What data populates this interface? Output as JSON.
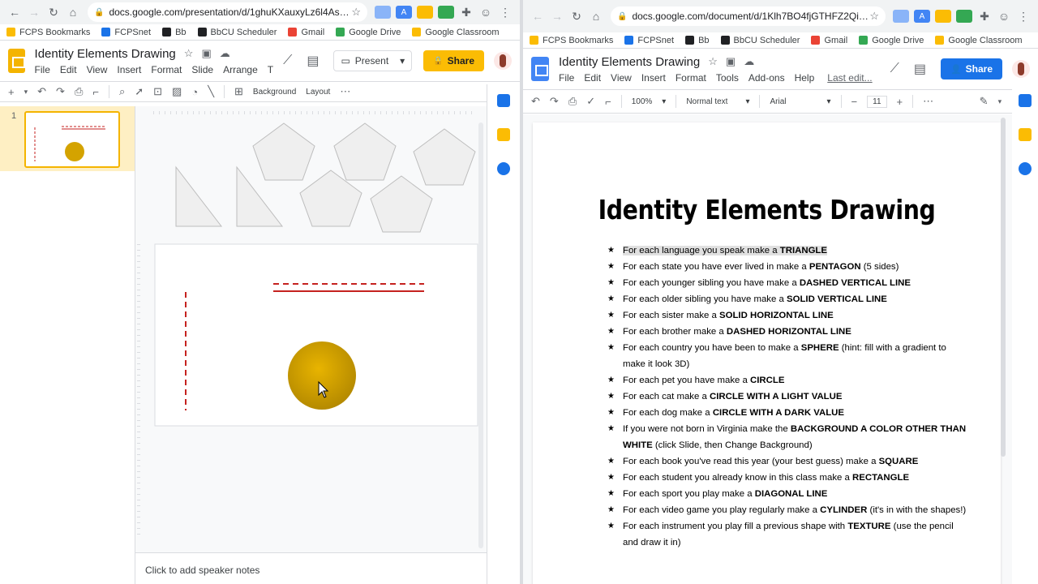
{
  "left": {
    "url": "docs.google.com/presentation/d/1ghuKXauxyLz6l4AsSO9wC...",
    "bookmarks": [
      "FCPS Bookmarks",
      "FCPSnet",
      "Bb",
      "BbCU Scheduler",
      "Gmail",
      "Google Drive",
      "Google Classroom"
    ],
    "title": "Identity Elements Drawing",
    "menus": [
      "File",
      "Edit",
      "View",
      "Insert",
      "Format",
      "Slide",
      "Arrange",
      "T"
    ],
    "present_label": "Present",
    "share_label": "Share",
    "toolbar": {
      "background": "Background",
      "layout": "Layout"
    },
    "slide_number": "1",
    "notes_placeholder": "Click to add speaker notes",
    "colors": {
      "slides_yellow": "#f4b400",
      "sphere": "#d4a300",
      "dashed_line": "#c5221f"
    }
  },
  "right": {
    "url": "docs.google.com/document/d/1Klh7BO4fjGTHFZ2QiFYoZrn5...",
    "bookmarks": [
      "FCPS Bookmarks",
      "FCPSnet",
      "Bb",
      "BbCU Scheduler",
      "Gmail",
      "Google Drive",
      "Google Classroom"
    ],
    "title": "Identity Elements Drawing",
    "menus": [
      "File",
      "Edit",
      "View",
      "Insert",
      "Format",
      "Tools",
      "Add-ons",
      "Help"
    ],
    "last_edit": "Last edit...",
    "share_label": "Share",
    "toolbar": {
      "zoom": "100%",
      "style": "Normal text",
      "font": "Arial",
      "size": "11"
    },
    "heading": "Identity Elements Drawing",
    "items": [
      {
        "pre": "For each language you speak make a ",
        "bold": "TRIANGLE",
        "post": ""
      },
      {
        "pre": "For each state you have ever lived in make a ",
        "bold": "PENTAGON",
        "post": " (5 sides)"
      },
      {
        "pre": "For each younger sibling you have make a ",
        "bold": "DASHED VERTICAL LINE",
        "post": ""
      },
      {
        "pre": "For each older sibling you have make a ",
        "bold": "SOLID VERTICAL LINE",
        "post": ""
      },
      {
        "pre": "For each sister make a ",
        "bold": "SOLID HORIZONTAL LINE",
        "post": ""
      },
      {
        "pre": "For each brother make a ",
        "bold": "DASHED HORIZONTAL LINE",
        "post": ""
      },
      {
        "pre": "For each country you have been to make a ",
        "bold": "SPHERE",
        "post": " (hint: fill with a gradient to make it look 3D)"
      },
      {
        "pre": "For each pet you have make a ",
        "bold": "CIRCLE",
        "post": ""
      },
      {
        "pre": "For each cat make a ",
        "bold": "CIRCLE WITH A LIGHT VALUE",
        "post": ""
      },
      {
        "pre": "For each dog make a ",
        "bold": "CIRCLE WITH A DARK VALUE",
        "post": ""
      },
      {
        "pre": "If you were not born in Virginia make the ",
        "bold": "BACKGROUND A COLOR OTHER THAN WHITE",
        "post": " (click Slide, then Change Background)"
      },
      {
        "pre": "For each book you've read this year (your best guess) make a ",
        "bold": "SQUARE",
        "post": ""
      },
      {
        "pre": "For each student you already know in this class make a ",
        "bold": "RECTANGLE",
        "post": ""
      },
      {
        "pre": "For each sport you play make a ",
        "bold": "DIAGONAL LINE",
        "post": ""
      },
      {
        "pre": "For each video game you play regularly make a ",
        "bold": "CYLINDER",
        "post": " (it's in with the shapes!)"
      },
      {
        "pre": "For each instrument you play fill a previous shape with ",
        "bold": "TEXTURE",
        "post": " (use the pencil and draw it in)"
      }
    ],
    "colors": {
      "docs_blue": "#4285f4",
      "share_blue": "#1a73e8"
    }
  }
}
